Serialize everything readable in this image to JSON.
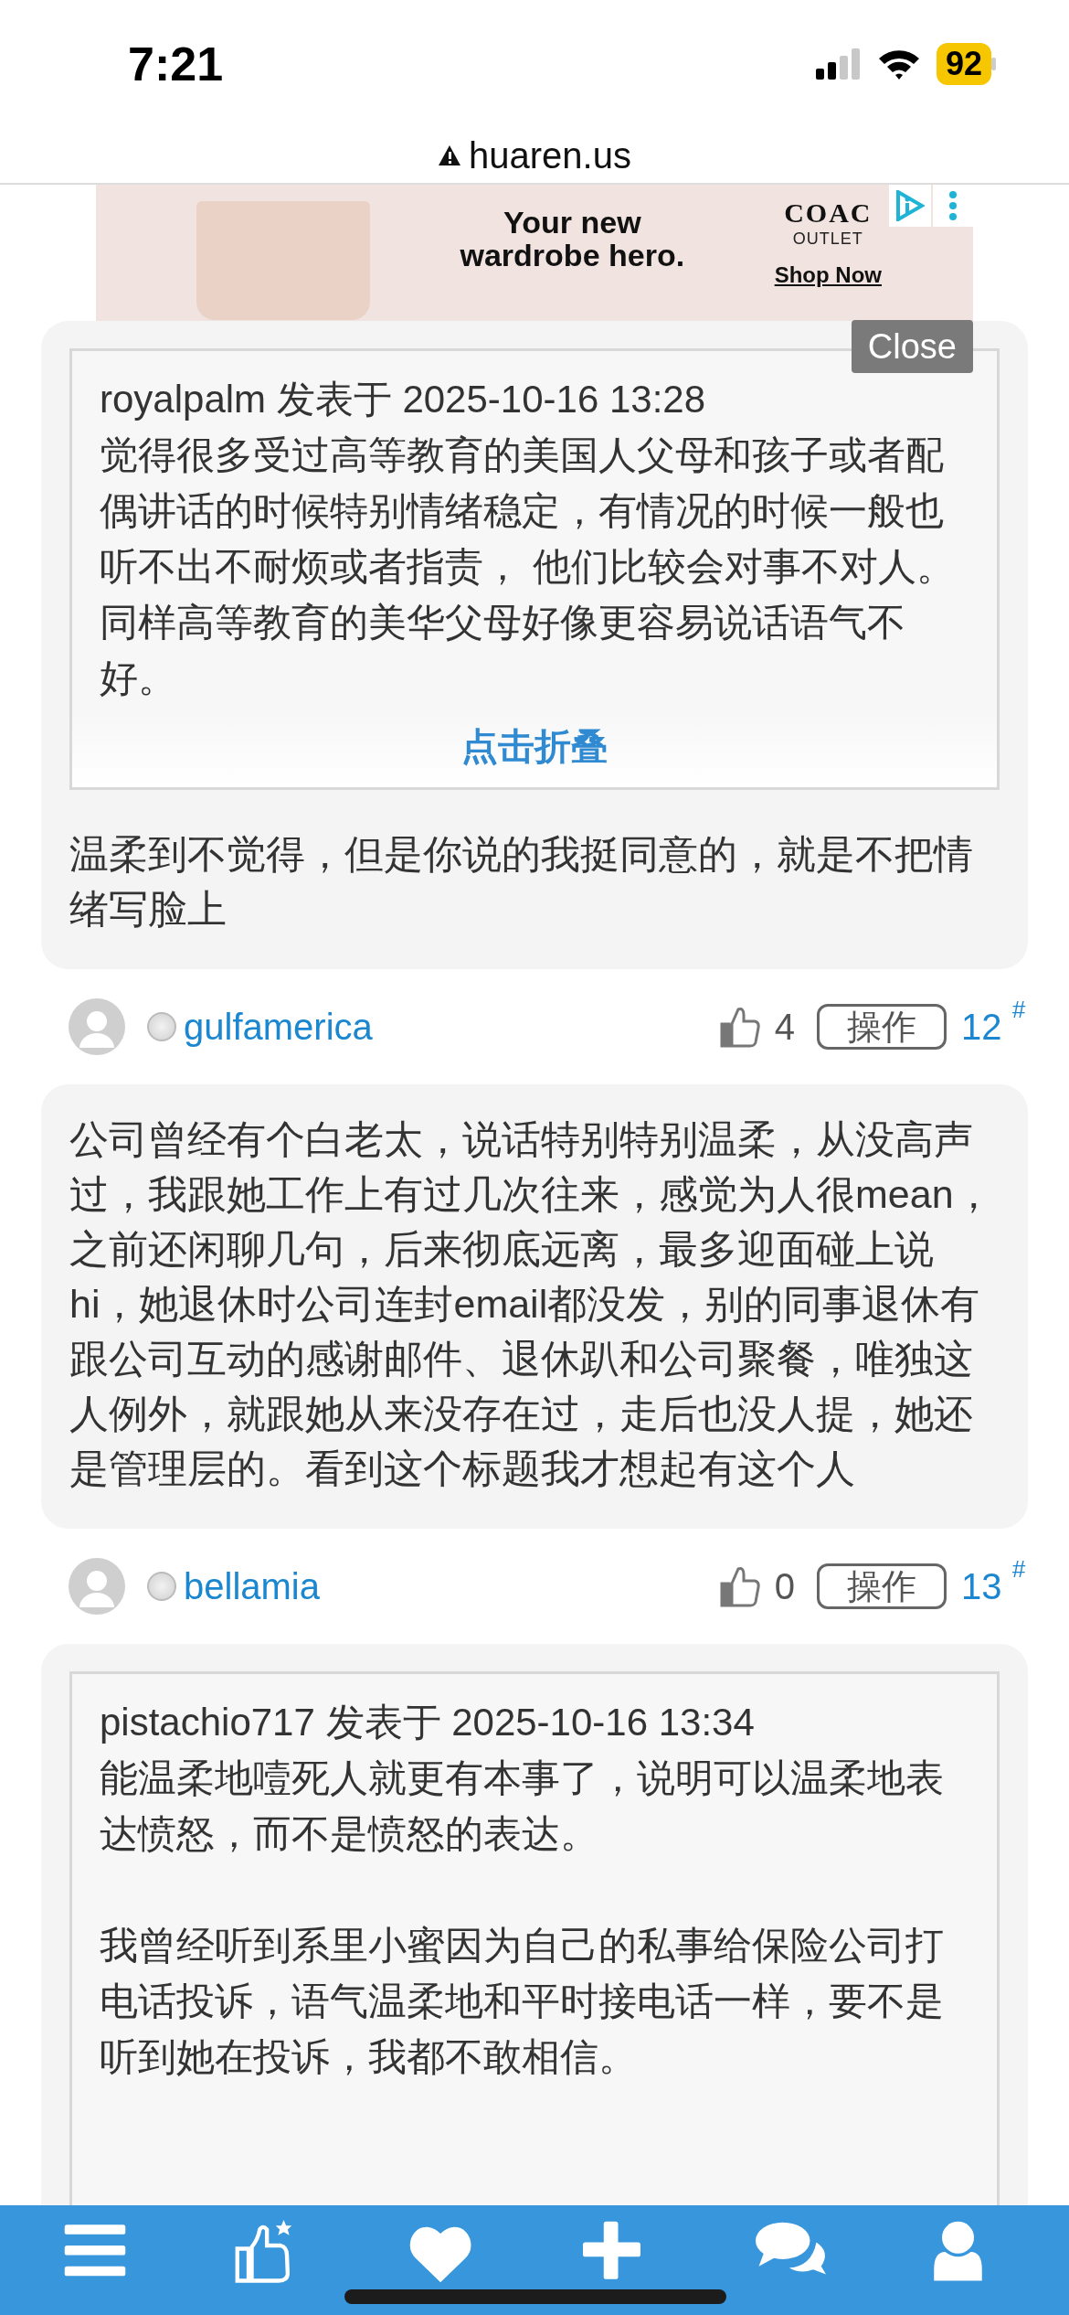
{
  "status_bar": {
    "time": "7:21",
    "battery": "92"
  },
  "browser": {
    "url": "huaren.us"
  },
  "ad": {
    "headline": "Your new wardrobe hero.",
    "brand": "COAC",
    "brand_sub": "OUTLET",
    "cta": "Shop Now",
    "close": "Close"
  },
  "posts": [
    {
      "quote": {
        "byline": "royalpalm 发表于 2025-10-16 13:28",
        "paragraphs": [
          "觉得很多受过高等教育的美国人父母和孩子或者配偶讲话的时候特别情绪稳定，有情况的时候一般也听不出不耐烦或者指责， 他们比较会对事不对人。同样高等教育的美华父母好像更容易说话语气不好。"
        ],
        "collapse": "点击折叠"
      },
      "body": "温柔到不觉得，但是你说的我挺同意的，就是不把情绪写脸上"
    },
    {
      "header": {
        "username": "gulfamerica",
        "online": false,
        "likes": "4",
        "action": "操作",
        "floor": "12",
        "floor_mark": "#"
      },
      "body": "公司曾经有个白老太，说话特别特别温柔，从没高声过，我跟她工作上有过几次往来，感觉为人很mean，之前还闲聊几句，后来彻底远离，最多迎面碰上说hi，她退休时公司连封email都没发，别的同事退休有跟公司互动的感谢邮件、退休趴和公司聚餐，唯独这人例外，就跟她从来没存在过，走后也没人提，她还是管理层的。看到这个标题我才想起有这个人"
    },
    {
      "header": {
        "username": "bellamia",
        "online": false,
        "likes": "0",
        "action": "操作",
        "floor": "13",
        "floor_mark": "#"
      },
      "quote": {
        "byline": "pistachio717 发表于 2025-10-16 13:34",
        "paragraphs": [
          "能温柔地噎死人就更有本事了，说明可以温柔地表达愤怒，而不是愤怒的表达。",
          "我曾经听到系里小蜜因为自己的私事给保险公司打电话投诉，语气温柔地和平时接电话一样，要不是听到她在投诉，我都不敢相信。"
        ]
      }
    }
  ],
  "bottom_nav": [
    {
      "kind": "menu"
    },
    {
      "kind": "like"
    },
    {
      "kind": "heart"
    },
    {
      "kind": "plus"
    },
    {
      "kind": "chat"
    },
    {
      "kind": "user"
    }
  ]
}
